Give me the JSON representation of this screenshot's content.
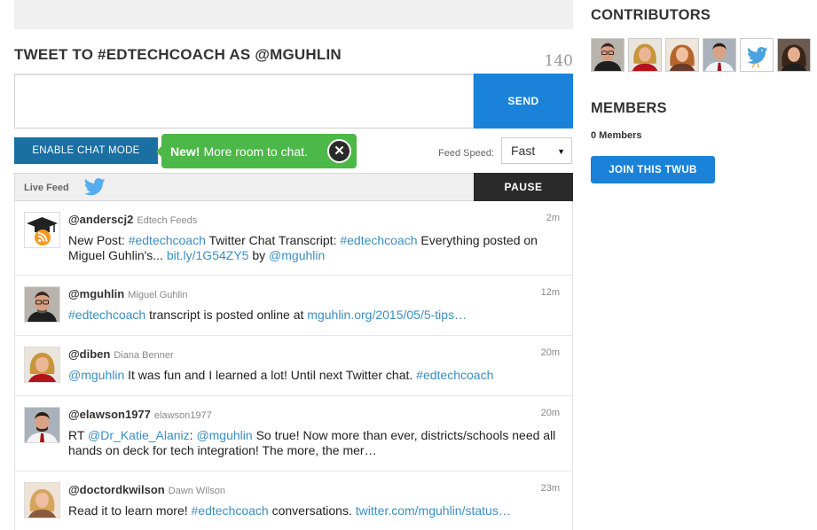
{
  "compose": {
    "title": "TWEET TO #EDTECHCOACH AS @MGUHLIN",
    "char_count": "140",
    "input_value": "",
    "send_label": "SEND"
  },
  "controls": {
    "chat_mode_label": "ENABLE CHAT MODE",
    "promo_strong": "New!",
    "promo_text": "More room to chat.",
    "feed_speed_label": "Feed Speed:",
    "feed_speed_value": "Fast",
    "feed_speed_options": [
      "Fast"
    ],
    "live_feed_label": "Live Feed",
    "pause_label": "PAUSE"
  },
  "feed": {
    "tweets": [
      {
        "handle": "@anderscj2",
        "name": "Edtech Feeds",
        "time": "2m",
        "avatar": "rss-graduation-cap-icon",
        "parts": [
          {
            "t": "New Post: "
          },
          {
            "t": "#edtechcoach",
            "link": true
          },
          {
            "t": " Twitter Chat Transcript: "
          },
          {
            "t": "#edtechcoach",
            "link": true
          },
          {
            "t": " Everything posted on Miguel Guhlin's... "
          },
          {
            "t": "bit.ly/1G54ZY5",
            "link": true
          },
          {
            "t": " by "
          },
          {
            "t": "@mguhlin",
            "link": true
          }
        ]
      },
      {
        "handle": "@mguhlin",
        "name": "Miguel Guhlin",
        "time": "12m",
        "avatar": "man-glasses-avatar",
        "parts": [
          {
            "t": "#edtechcoach",
            "link": true
          },
          {
            "t": " transcript is posted online at "
          },
          {
            "t": "mguhlin.org/2015/05/5-tips…",
            "link": true
          }
        ]
      },
      {
        "handle": "@diben",
        "name": "Diana Benner",
        "time": "20m",
        "avatar": "woman-blonde-avatar",
        "parts": [
          {
            "t": "@mguhlin",
            "link": true
          },
          {
            "t": " It was fun and I learned a lot! Until next Twitter chat. "
          },
          {
            "t": "#edtechcoach",
            "link": true
          }
        ]
      },
      {
        "handle": "@elawson1977",
        "name": "elawson1977",
        "time": "20m",
        "avatar": "man-tie-avatar",
        "parts": [
          {
            "t": "RT "
          },
          {
            "t": "@Dr_Katie_Alaniz",
            "link": true
          },
          {
            "t": ": "
          },
          {
            "t": "@mguhlin",
            "link": true
          },
          {
            "t": " So true! Now more than ever, districts/schools need all hands on deck for tech integration! The more, the mer…"
          }
        ]
      },
      {
        "handle": "@doctordkwilson",
        "name": "Dawn Wilson",
        "time": "23m",
        "avatar": "woman-blonde-avatar",
        "parts": [
          {
            "t": "Read it to learn more! "
          },
          {
            "t": "#edtechcoach",
            "link": true
          },
          {
            "t": " conversations. "
          },
          {
            "t": "twitter.com/mguhlin/status…",
            "link": true
          }
        ]
      }
    ]
  },
  "sidebar": {
    "contributors_title": "CONTRIBUTORS",
    "contributors": [
      {
        "avatar": "man-glasses-avatar"
      },
      {
        "avatar": "woman-blonde-avatar"
      },
      {
        "avatar": "woman-redhead-avatar"
      },
      {
        "avatar": "man-tie-avatar"
      },
      {
        "avatar": "twitter-bird-avatar"
      },
      {
        "avatar": "woman-dark-hair-avatar"
      }
    ],
    "members_title": "MEMBERS",
    "members_count": "0 Members",
    "join_label": "JOIN THIS TWUB"
  },
  "colors": {
    "primary_blue": "#1a82d8",
    "chat_mode_blue": "#1a6fa3",
    "promo_green": "#4cb848",
    "link_blue": "#3a8ec4",
    "pause_dark": "#2a2a2a"
  }
}
